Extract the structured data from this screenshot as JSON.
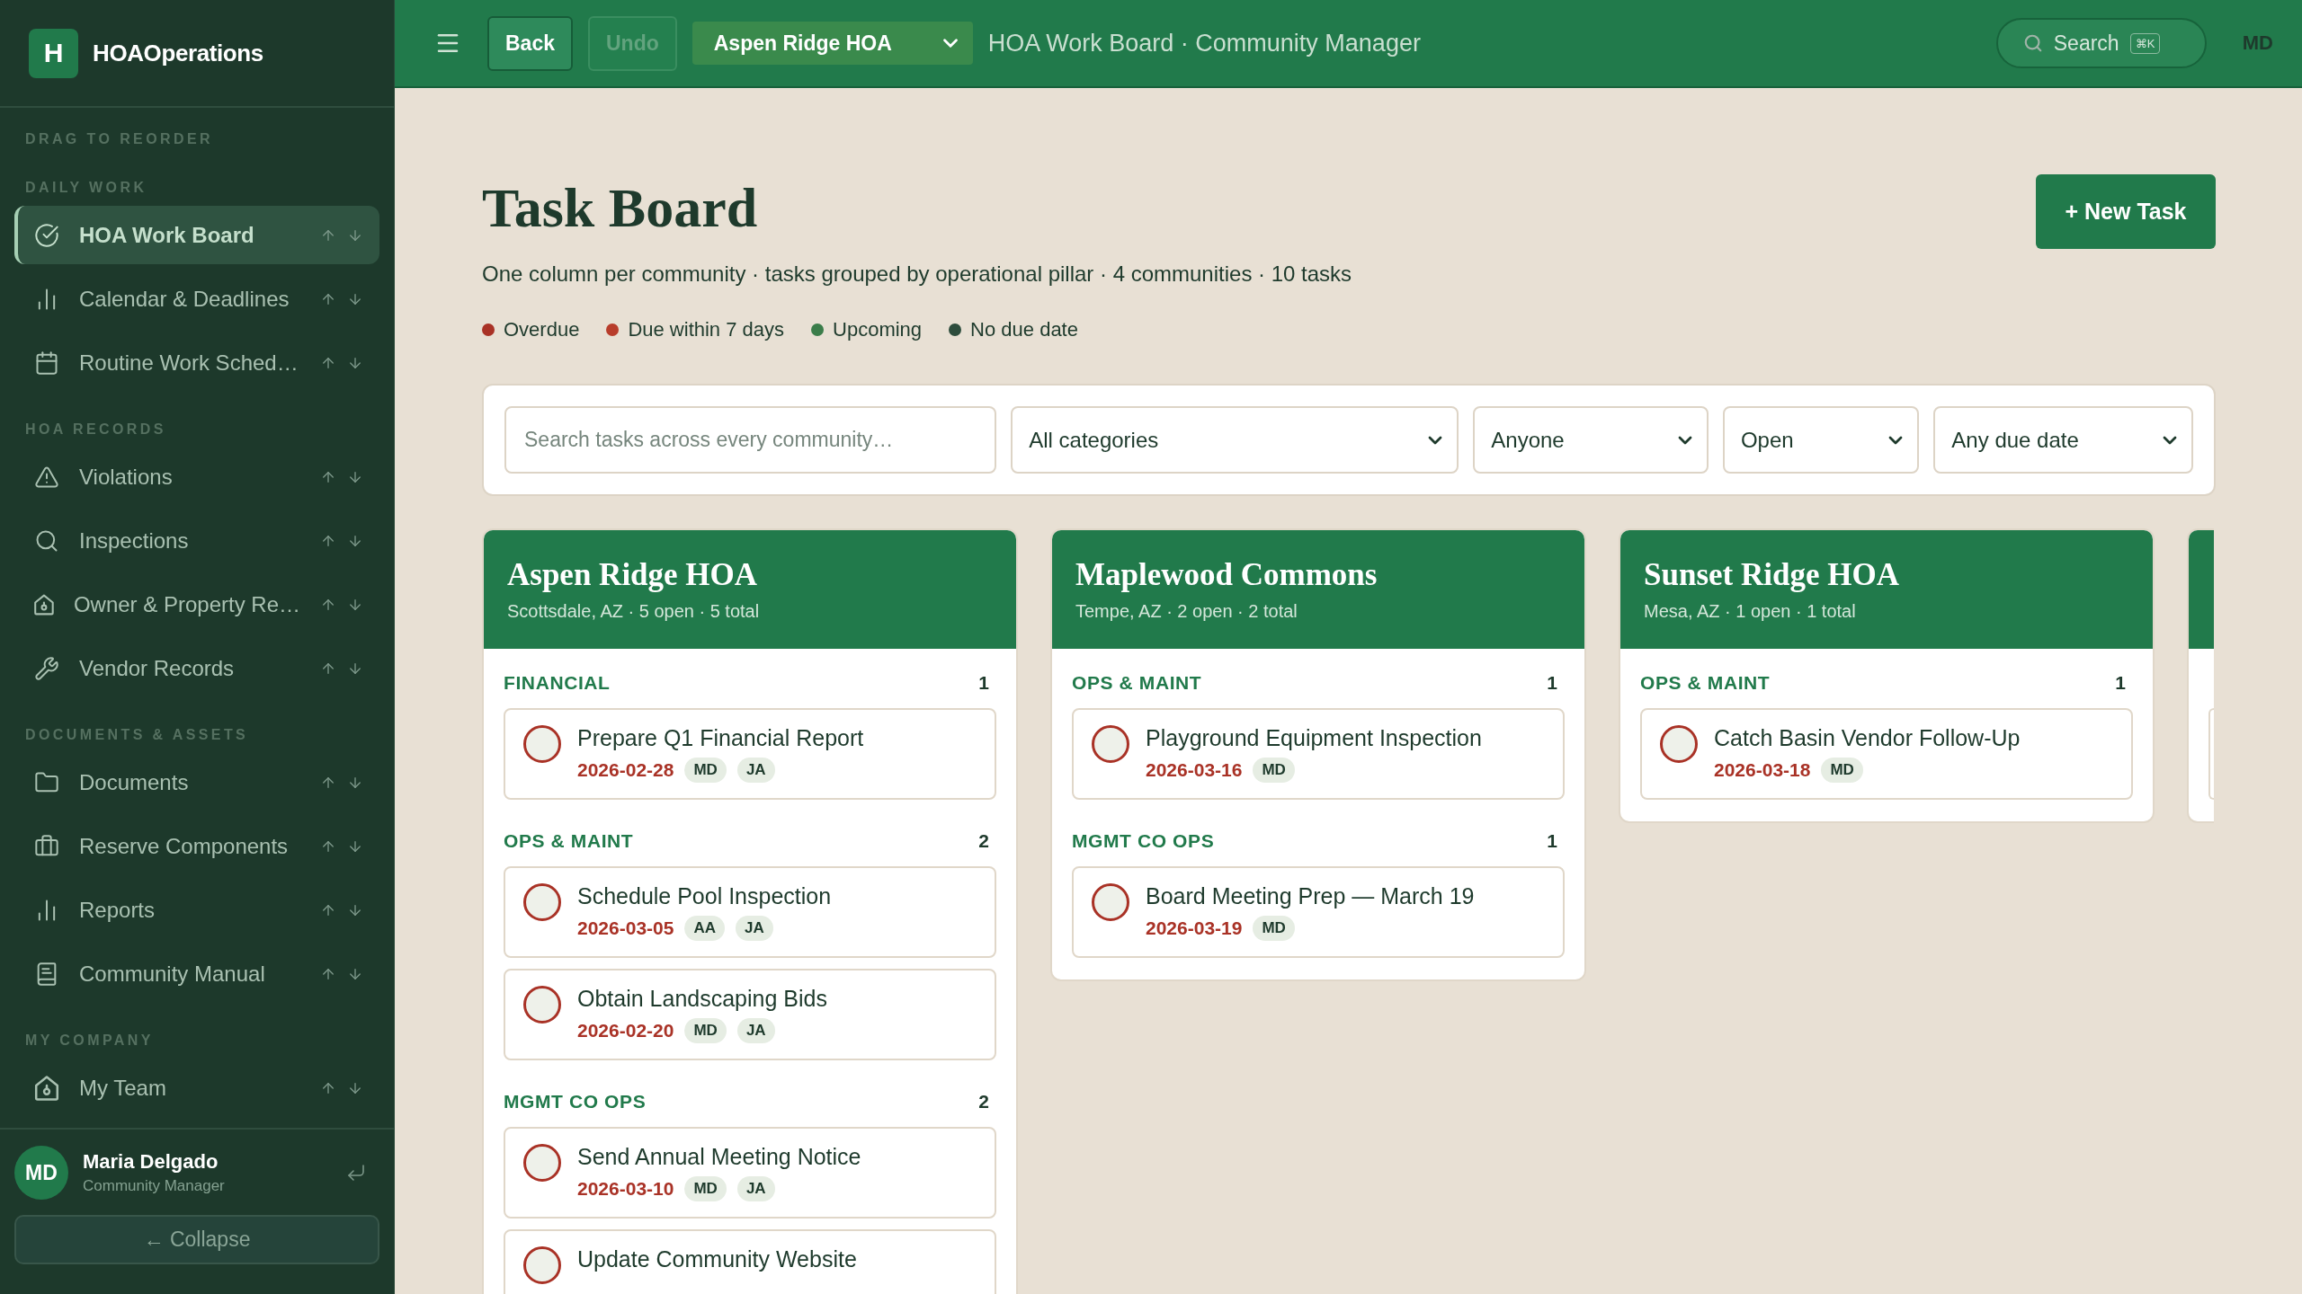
{
  "sidebar": {
    "brand": {
      "logo_letter": "H",
      "name": "HOAOperations"
    },
    "hint": "DRAG TO REORDER",
    "groups": [
      {
        "label": "DAILY WORK",
        "items": [
          {
            "label": "HOA Work Board",
            "selected": true
          },
          {
            "label": "Calendar & Deadlines",
            "selected": false
          },
          {
            "label": "Routine Work Sched…",
            "selected": false
          }
        ]
      },
      {
        "label": "HOA RECORDS",
        "items": [
          {
            "label": "Violations",
            "selected": false
          },
          {
            "label": "Inspections",
            "selected": false
          },
          {
            "label": "Owner & Property Re…",
            "selected": false
          },
          {
            "label": "Vendor Records",
            "selected": false
          }
        ]
      },
      {
        "label": "DOCUMENTS & ASSETS",
        "items": [
          {
            "label": "Documents",
            "selected": false
          },
          {
            "label": "Reserve Components",
            "selected": false
          },
          {
            "label": "Reports",
            "selected": false
          },
          {
            "label": "Community Manual",
            "selected": false
          }
        ]
      },
      {
        "label": "MY COMPANY",
        "items": [
          {
            "label": "My Team",
            "selected": false
          }
        ]
      }
    ],
    "user": {
      "initials": "MD",
      "name": "Maria Delgado",
      "role": "Community Manager"
    },
    "collapse": "← Collapse"
  },
  "topbar": {
    "buttons": [
      {
        "label": "Back",
        "disabled": false
      },
      {
        "label": "Undo",
        "disabled": true
      }
    ],
    "community_select": "Aspen Ridge HOA",
    "title": "HOA Work Board · Community Manager",
    "search": {
      "label": "Search",
      "shortcut": "⌘K"
    },
    "user_initials": "MD"
  },
  "page": {
    "title": "Task Board",
    "subtitle": "One column per community · tasks grouped by operational pillar · 4 communities · 10 tasks",
    "new_button": "+ New Task",
    "legend": [
      {
        "label": "Overdue",
        "color": "#a93226"
      },
      {
        "label": "Due within 7 days",
        "color": "#b83d2b"
      },
      {
        "label": "Upcoming",
        "color": "#3b7d4a"
      },
      {
        "label": "No due date",
        "color": "#2e4d3d"
      }
    ]
  },
  "filters": {
    "search": {
      "placeholder": "Search tasks across every community…"
    },
    "selects": [
      "All categories",
      "Anyone",
      "Open",
      "Any due date"
    ]
  },
  "columns": [
    {
      "kind": "full",
      "name": "Aspen Ridge HOA",
      "subtitle": "Scottsdale, AZ · 5 open · 5 total",
      "sections": [
        {
          "name": "FINANCIAL",
          "count": "1",
          "tasks": [
            {
              "title": "Prepare Q1 Financial Report",
              "due": "2026-02-28",
              "overdue": true,
              "done": false,
              "assignees": [
                "MD",
                "JA"
              ]
            }
          ]
        },
        {
          "name": "OPS & MAINT",
          "count": "2",
          "tasks": [
            {
              "title": "Schedule Pool Inspection",
              "due": "2026-03-05",
              "overdue": true,
              "done": false,
              "assignees": [
                "AA",
                "JA"
              ]
            },
            {
              "title": "Obtain Landscaping Bids",
              "due": "2026-02-20",
              "overdue": true,
              "done": false,
              "assignees": [
                "MD",
                "JA"
              ]
            }
          ]
        },
        {
          "name": "MGMT CO OPS",
          "count": "2",
          "tasks": [
            {
              "title": "Send Annual Meeting Notice",
              "due": "2026-03-10",
              "overdue": true,
              "done": false,
              "assignees": [
                "MD",
                "JA"
              ]
            },
            {
              "title": "Update Community Website",
              "overdue": true,
              "done": false
            }
          ]
        }
      ]
    },
    {
      "kind": "full",
      "name": "Maplewood Commons",
      "subtitle": "Tempe, AZ · 2 open · 2 total",
      "sections": [
        {
          "name": "OPS & MAINT",
          "count": "1",
          "tasks": [
            {
              "title": "Playground Equipment Inspection",
              "due": "2026-03-16",
              "overdue": true,
              "done": false,
              "assignees": [
                "MD"
              ]
            }
          ]
        },
        {
          "name": "MGMT CO OPS",
          "count": "1",
          "tasks": [
            {
              "title": "Board Meeting Prep — March 19",
              "due": "2026-03-19",
              "overdue": true,
              "done": false,
              "assignees": [
                "MD"
              ]
            }
          ]
        }
      ]
    },
    {
      "kind": "full",
      "name": "Sunset Ridge HOA",
      "subtitle": "Mesa, AZ · 1 open · 1 total",
      "sections": [
        {
          "name": "OPS & MAINT",
          "count": "1",
          "tasks": [
            {
              "title": "Catch Basin Vendor Follow-Up",
              "due": "2026-03-18",
              "overdue": true,
              "done": false,
              "assignees": [
                "MD"
              ]
            }
          ]
        }
      ]
    },
    {
      "kind": "peek"
    }
  ]
}
